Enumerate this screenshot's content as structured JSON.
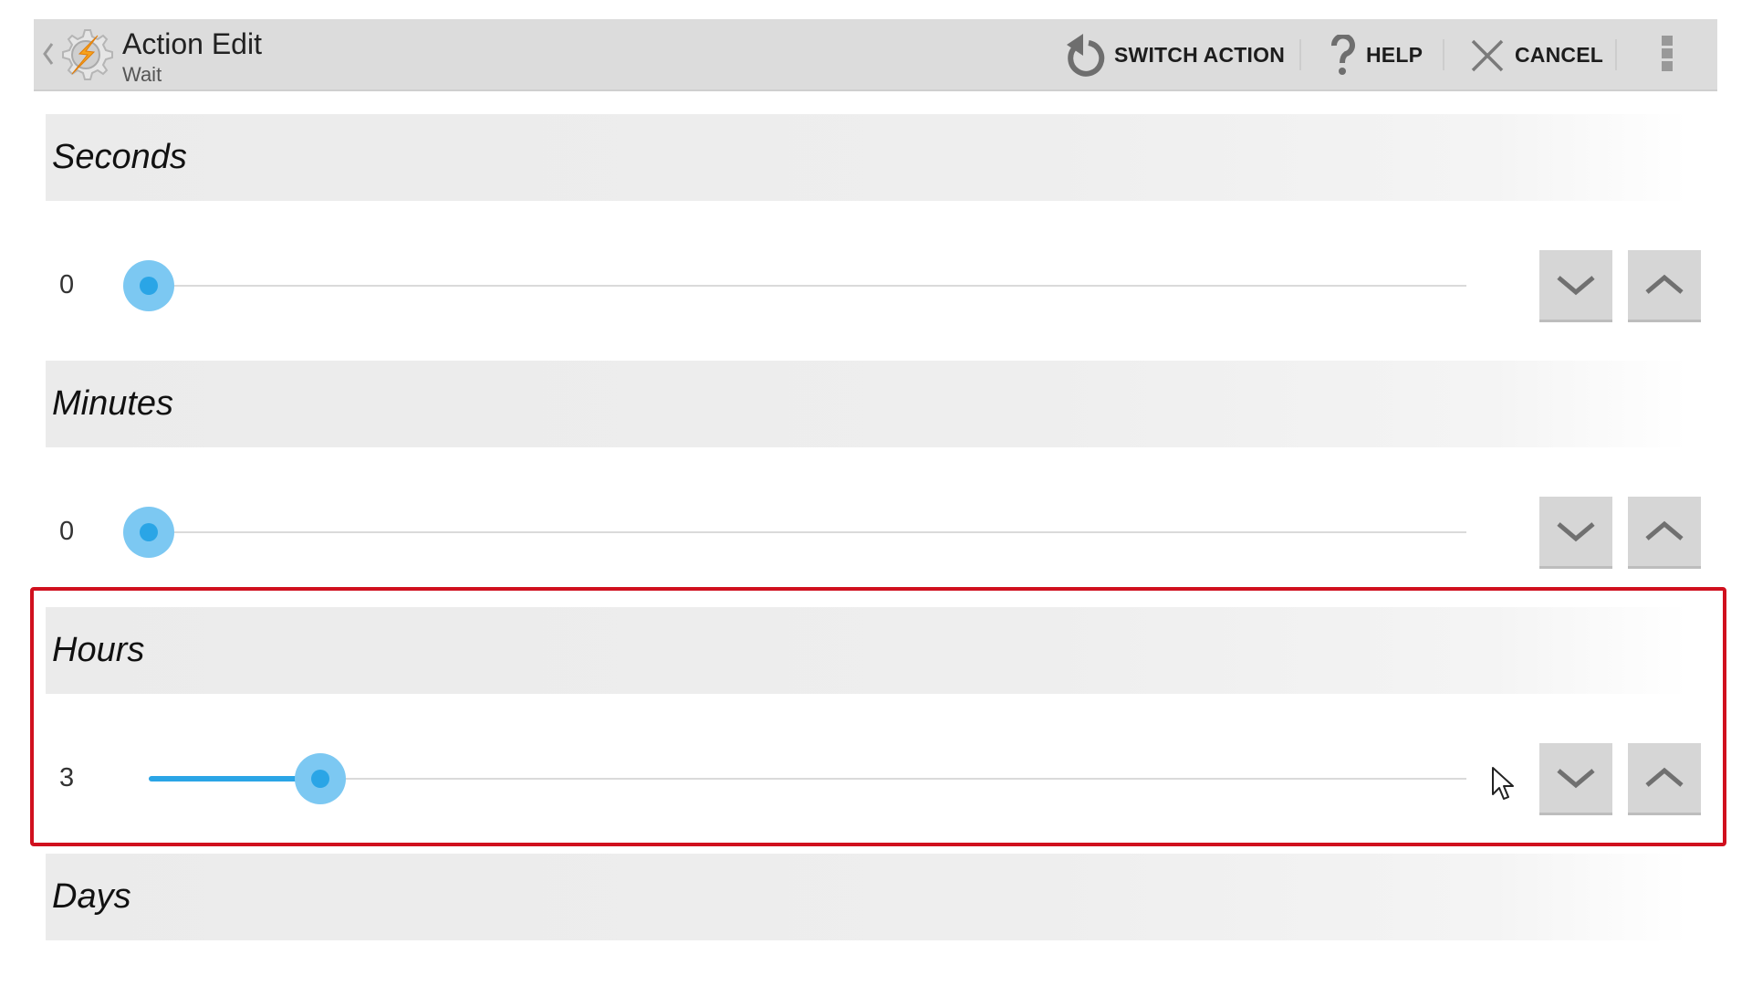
{
  "actionbar": {
    "title": "Action Edit",
    "subtitle": "Wait",
    "back_icon": "chevron-left-icon",
    "app_icon": "tasker-gear-lightning-icon",
    "buttons": [
      {
        "label": "SWITCH ACTION",
        "icon": "rotate-ccw-icon"
      },
      {
        "label": "HELP",
        "icon": "question-mark-icon"
      },
      {
        "label": "CANCEL",
        "icon": "close-x-icon"
      }
    ],
    "overflow_icon": "more-vertical-icon"
  },
  "fields": [
    {
      "label": "Seconds",
      "value": "0",
      "min": 0,
      "max": 59,
      "fraction": 0.0
    },
    {
      "label": "Minutes",
      "value": "0",
      "min": 0,
      "max": 59,
      "fraction": 0.0
    },
    {
      "label": "Hours",
      "value": "3",
      "min": 0,
      "max": 23,
      "fraction": 0.13,
      "highlighted": true
    },
    {
      "label": "Days"
    }
  ],
  "stepper": {
    "decrement_icon": "chevron-down-icon",
    "increment_icon": "chevron-up-icon"
  },
  "colors": {
    "accent": "#2aa5e6",
    "thumb_halo": "#7cc8f2",
    "highlight_box": "#d0101e",
    "actionbar_bg": "#dcdcdc"
  }
}
